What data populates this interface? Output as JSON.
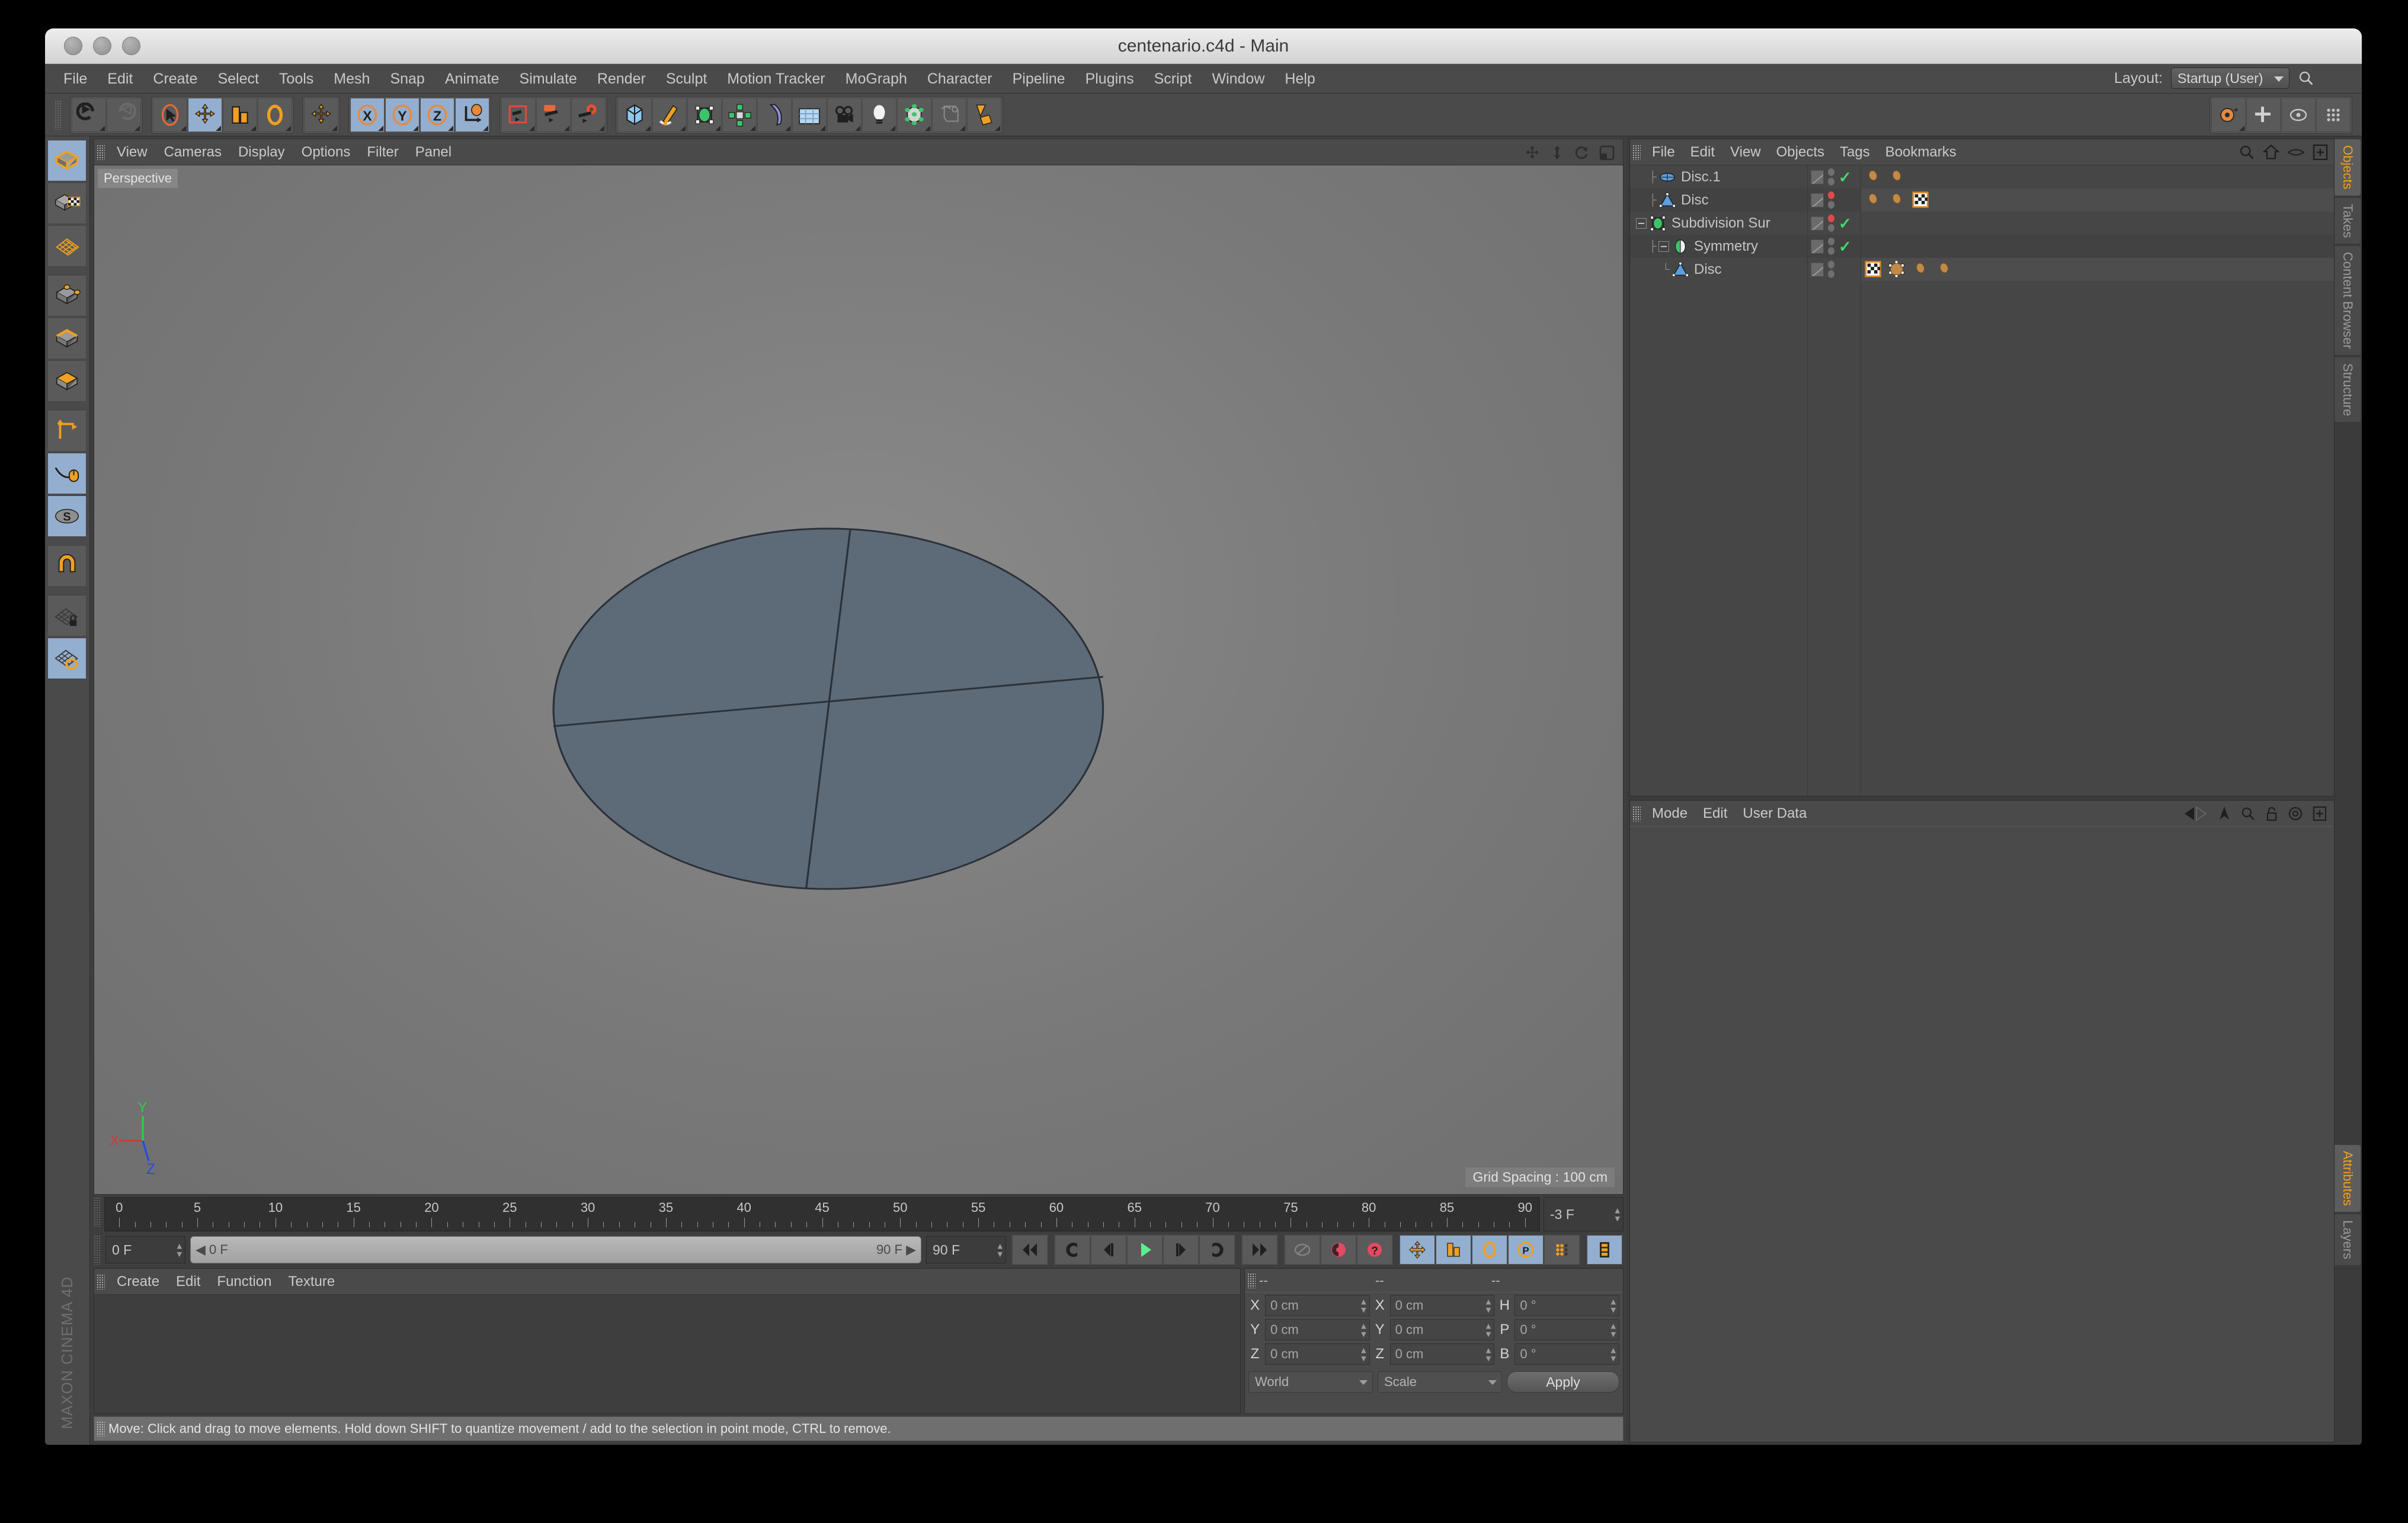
{
  "window": {
    "title": "centenario.c4d - Main",
    "traffic_lights": [
      "close",
      "minimize",
      "zoom"
    ]
  },
  "menubar": {
    "items": [
      "File",
      "Edit",
      "Create",
      "Select",
      "Tools",
      "Mesh",
      "Snap",
      "Animate",
      "Simulate",
      "Render",
      "Sculpt",
      "Motion Tracker",
      "MoGraph",
      "Character",
      "Pipeline",
      "Plugins",
      "Script",
      "Window",
      "Help"
    ],
    "layout_label": "Layout:",
    "layout_value": "Startup (User)",
    "search_icon": "search-icon"
  },
  "toolbar": {
    "groups": [
      {
        "name": "undo-redo",
        "buttons": [
          {
            "icon": "undo-icon",
            "selected": false
          },
          {
            "icon": "redo-icon",
            "selected": false
          }
        ]
      },
      {
        "name": "transform-tools",
        "buttons": [
          {
            "icon": "select-live-icon",
            "selected": false
          },
          {
            "icon": "move-icon",
            "selected": true
          },
          {
            "icon": "scale-icon",
            "selected": false
          },
          {
            "icon": "rotate-icon",
            "selected": false
          }
        ]
      },
      {
        "name": "move-axis",
        "buttons": [
          {
            "icon": "move-tool-icon",
            "selected": false
          }
        ]
      },
      {
        "name": "axis-locks",
        "buttons": [
          {
            "icon": "x-axis-icon",
            "selected": true
          },
          {
            "icon": "y-axis-icon",
            "selected": true
          },
          {
            "icon": "z-axis-icon",
            "selected": true
          },
          {
            "icon": "world-coordinate-icon",
            "selected": true
          }
        ]
      },
      {
        "name": "render-tools",
        "buttons": [
          {
            "icon": "render-view-icon",
            "selected": false
          },
          {
            "icon": "render-region-icon",
            "selected": false
          },
          {
            "icon": "render-settings-icon",
            "selected": false
          }
        ]
      },
      {
        "name": "object-tools",
        "buttons": [
          {
            "icon": "cube-primitive-icon",
            "selected": false
          },
          {
            "icon": "spline-pen-icon",
            "selected": false
          },
          {
            "icon": "subdivision-surface-icon",
            "selected": false
          },
          {
            "icon": "array-generator-icon",
            "selected": false
          },
          {
            "icon": "bend-deformer-icon",
            "selected": false
          },
          {
            "icon": "floor-environment-icon",
            "selected": false
          },
          {
            "icon": "camera-icon",
            "selected": false
          },
          {
            "icon": "light-icon",
            "selected": false
          },
          {
            "icon": "mograph-cloner-icon",
            "selected": false
          },
          {
            "icon": "simulation-icon",
            "selected": false
          },
          {
            "icon": "paint-tool-icon",
            "selected": false
          }
        ]
      }
    ]
  },
  "left_toolbar": {
    "buttons": [
      {
        "icon": "model-mode-icon",
        "selected": true
      },
      {
        "icon": "texture-mode-icon",
        "selected": false
      },
      {
        "icon": "workplane-mode-icon",
        "selected": false
      },
      {
        "icon": "points-mode-icon",
        "selected": false
      },
      {
        "icon": "edges-mode-icon",
        "selected": false
      },
      {
        "icon": "polygons-mode-icon",
        "selected": false
      },
      {
        "icon": "object-axis-icon",
        "selected": false
      },
      {
        "icon": "viewport-solo-icon",
        "selected": true
      },
      {
        "icon": "soft-selection-icon",
        "selected": true
      },
      {
        "icon": "magnet-snap-icon",
        "selected": false
      },
      {
        "icon": "workplane-lock-icon",
        "selected": false
      },
      {
        "icon": "workplane-rotate-icon",
        "selected": true
      }
    ]
  },
  "viewport": {
    "menu": [
      "View",
      "Cameras",
      "Display",
      "Options",
      "Filter",
      "Panel"
    ],
    "camera_tag": "Perspective",
    "grid_spacing": "Grid Spacing : 100 cm",
    "corner_icons": [
      "pan-viewport-icon",
      "dolly-viewport-icon",
      "rotate-viewport-icon",
      "maximize-viewport-icon"
    ],
    "axis_gizmo": {
      "x_label": "X",
      "y_label": "Y",
      "z_label": "Z",
      "x_color": "#d03a3a",
      "y_color": "#2ecc40",
      "z_color": "#2b4cd8"
    },
    "object": {
      "name": "disc-mesh",
      "fill_color": "#5d6a78",
      "edge_color": "#2b3138"
    }
  },
  "timeline": {
    "ticks": [
      0,
      5,
      10,
      15,
      20,
      25,
      30,
      35,
      40,
      45,
      50,
      55,
      60,
      65,
      70,
      75,
      80,
      85,
      90
    ],
    "range_end_field": "-3 F",
    "current_frame": "0 F",
    "slider_start": "0 F",
    "slider_end": "90 F",
    "end_frame": "90 F",
    "transport": [
      {
        "icon": "go-to-start-icon",
        "selected": false
      },
      {
        "icon": "play-backward-loop-icon",
        "selected": false
      },
      {
        "icon": "step-back-icon",
        "selected": false
      },
      {
        "icon": "play-icon",
        "selected": false
      },
      {
        "icon": "step-forward-icon",
        "selected": false
      },
      {
        "icon": "play-forward-loop-icon",
        "selected": false
      },
      {
        "icon": "go-to-end-icon",
        "selected": false
      }
    ],
    "record_tools": [
      {
        "icon": "autokey-icon",
        "selected": false
      },
      {
        "icon": "record-active-objects-icon",
        "selected": false
      },
      {
        "icon": "autokeying-icon",
        "selected": false
      }
    ],
    "key_tools": [
      {
        "icon": "position-key-icon",
        "selected": true
      },
      {
        "icon": "scale-key-icon",
        "selected": true
      },
      {
        "icon": "rotation-key-icon",
        "selected": true
      },
      {
        "icon": "parameter-key-icon",
        "selected": true
      },
      {
        "icon": "point-level-animation-icon",
        "selected": false
      }
    ],
    "extra_tools": [
      {
        "icon": "timeline-filmstrip-icon",
        "selected": true
      }
    ]
  },
  "material_manager": {
    "menu": [
      "Create",
      "Edit",
      "Function",
      "Texture"
    ]
  },
  "coordinate_manager": {
    "headers": [
      "--",
      "--",
      "--"
    ],
    "rows": [
      {
        "pos_label": "X",
        "pos_value": "0 cm",
        "size_label": "X",
        "size_value": "0 cm",
        "rot_label": "H",
        "rot_value": "0 °"
      },
      {
        "pos_label": "Y",
        "pos_value": "0 cm",
        "size_label": "Y",
        "size_value": "0 cm",
        "rot_label": "P",
        "rot_value": "0 °"
      },
      {
        "pos_label": "Z",
        "pos_value": "0 cm",
        "size_label": "Z",
        "size_value": "0 cm",
        "rot_label": "B",
        "rot_value": "0 °"
      }
    ],
    "coord_system": "World",
    "size_mode": "Scale",
    "apply_label": "Apply"
  },
  "statusbar": {
    "message": "Move: Click and drag to move elements. Hold down SHIFT to quantize movement / add to the selection in point mode, CTRL to remove."
  },
  "object_manager": {
    "menu": [
      "File",
      "Edit",
      "View",
      "Objects",
      "Tags",
      "Bookmarks"
    ],
    "header_icons": [
      "search-icon",
      "home-icon",
      "eye-icon",
      "add-layer-icon"
    ],
    "rows": [
      {
        "name": "Disc.1",
        "indent": 1,
        "icon": "disc-object-icon",
        "icon_color": "#5aa0e0",
        "expander": "none",
        "visibility_top": "gray",
        "visibility_bottom": "gray",
        "enabled": true,
        "tags": [
          "texture-tag-brown",
          "texture-tag-brown"
        ]
      },
      {
        "name": "Disc",
        "indent": 1,
        "icon": "polygon-object-icon",
        "icon_color": "#5aa0e0",
        "expander": "none",
        "visibility_top": "red",
        "visibility_bottom": "gray",
        "enabled": false,
        "tags": [
          "texture-tag-brown",
          "texture-tag-brown",
          "checker-material-tag"
        ]
      },
      {
        "name": "Subdivision Sur",
        "indent": 0,
        "icon": "subdivision-surface-icon",
        "icon_color": "#3dc46a",
        "expander": "minus",
        "visibility_top": "red",
        "visibility_bottom": "gray",
        "enabled": true,
        "tags": []
      },
      {
        "name": "Symmetry",
        "indent": 1,
        "icon": "symmetry-object-icon",
        "icon_color": "#3dc46a",
        "expander": "minus",
        "visibility_top": "gray",
        "visibility_bottom": "gray",
        "enabled": true,
        "tags": []
      },
      {
        "name": "Disc",
        "indent": 2,
        "icon": "polygon-object-icon",
        "icon_color": "#5aa0e0",
        "expander": "none",
        "visibility_top": "gray",
        "visibility_bottom": "gray",
        "enabled": false,
        "tags": [
          "checker-material-tag",
          "phong-tag-brown",
          "texture-tag-brown",
          "texture-tag-brown"
        ]
      }
    ]
  },
  "attribute_manager": {
    "menu": [
      "Mode",
      "Edit",
      "User Data"
    ],
    "header_icons": [
      "back-forward-nav-icon",
      "pin-icon",
      "search-icon",
      "lock-icon",
      "target-icon",
      "add-tab-icon"
    ]
  },
  "right_tabs": {
    "top": [
      {
        "label": "Objects",
        "active": true
      },
      {
        "label": "Takes",
        "active": false
      },
      {
        "label": "Content Browser",
        "active": false
      },
      {
        "label": "Structure",
        "active": false
      }
    ],
    "bottom": [
      {
        "label": "Attributes",
        "active": true
      },
      {
        "label": "Layers",
        "active": false
      }
    ]
  },
  "watermark": {
    "line1": "MAXON",
    "line2": "CINEMA 4D"
  },
  "colors": {
    "accent_orange": "#f0a020",
    "selected_blue": "#93aece",
    "panel_bg": "#4a4a4a",
    "viewport_bg": "#7d7d7d"
  }
}
